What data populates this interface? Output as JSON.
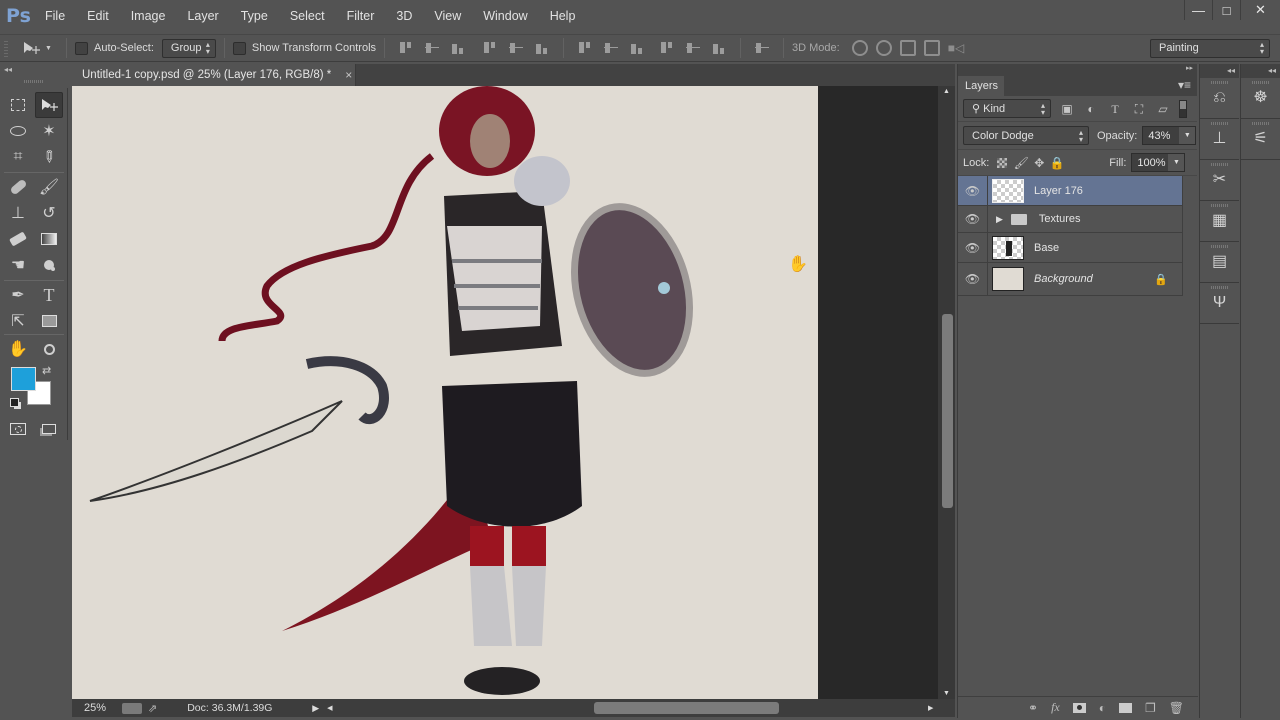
{
  "app": {
    "logo": "Ps"
  },
  "menu": [
    "File",
    "Edit",
    "Image",
    "Layer",
    "Type",
    "Select",
    "Filter",
    "3D",
    "View",
    "Window",
    "Help"
  ],
  "window_controls": {
    "minimize": "—",
    "maximize": "□",
    "close": "✕"
  },
  "options_bar": {
    "tool_icon": "move-tool-icon",
    "auto_select_label": "Auto-Select:",
    "auto_select_checked": false,
    "auto_select_target": "Group",
    "show_transform_label": "Show Transform Controls",
    "show_transform_checked": false,
    "mode3d_label": "3D Mode:",
    "workspace": "Painting"
  },
  "document": {
    "tab_title": "Untitled-1 copy.psd @ 25% (Layer 176, RGB/8) *",
    "close_glyph": "×",
    "canvas_color": "#e0dbd3",
    "artwork_description": "Digital painting of a red-haired female warrior in silver armor holding a sword and round scaled shield"
  },
  "status_bar": {
    "zoom": "25%",
    "doc_info": "Doc: 36.3M/1.39G"
  },
  "colors": {
    "foreground": "#1ea0da",
    "background": "#ffffff",
    "selected_layer": "#647493"
  },
  "layers_panel": {
    "title": "Layers",
    "filter_kind": "Kind",
    "blend_mode": "Color Dodge",
    "opacity_label": "Opacity:",
    "opacity": "43%",
    "lock_label": "Lock:",
    "fill_label": "Fill:",
    "fill": "100%",
    "layers": [
      {
        "name": "Layer 176",
        "visible": true,
        "selected": true,
        "type": "pixel"
      },
      {
        "name": "Textures",
        "visible": true,
        "selected": false,
        "type": "group"
      },
      {
        "name": "Base",
        "visible": true,
        "selected": false,
        "type": "pixel"
      },
      {
        "name": "Background",
        "visible": true,
        "selected": false,
        "type": "background",
        "locked": true
      }
    ]
  }
}
